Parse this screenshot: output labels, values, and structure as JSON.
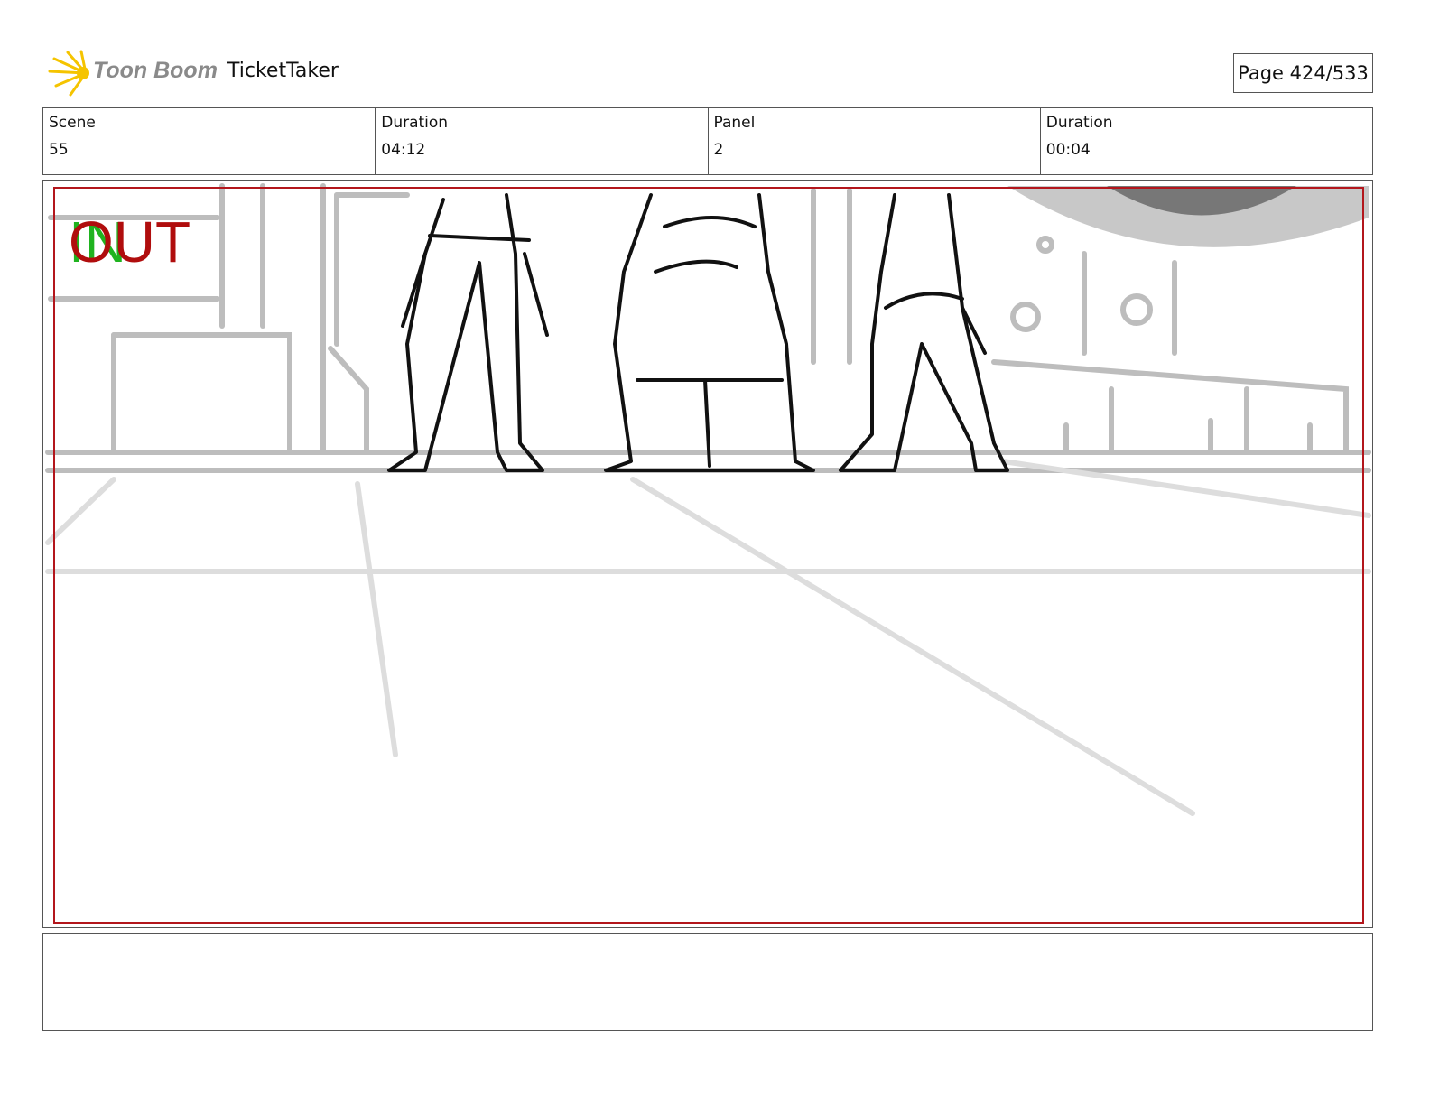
{
  "header": {
    "logo_text": "Toon Boom",
    "project": "TicketTaker",
    "page": "Page 424/533"
  },
  "info": [
    {
      "label": "Scene",
      "value": "55"
    },
    {
      "label": "Duration",
      "value": "04:12"
    },
    {
      "label": "Panel",
      "value": "2"
    },
    {
      "label": "Duration",
      "value": "00:04"
    }
  ],
  "panel": {
    "in_label": "IN",
    "out_label": "OUT"
  },
  "colors": {
    "safe_frame": "#b3161c",
    "in": "#1fb31f",
    "out": "#b00d0d",
    "logo_flare": "#f5c400"
  }
}
